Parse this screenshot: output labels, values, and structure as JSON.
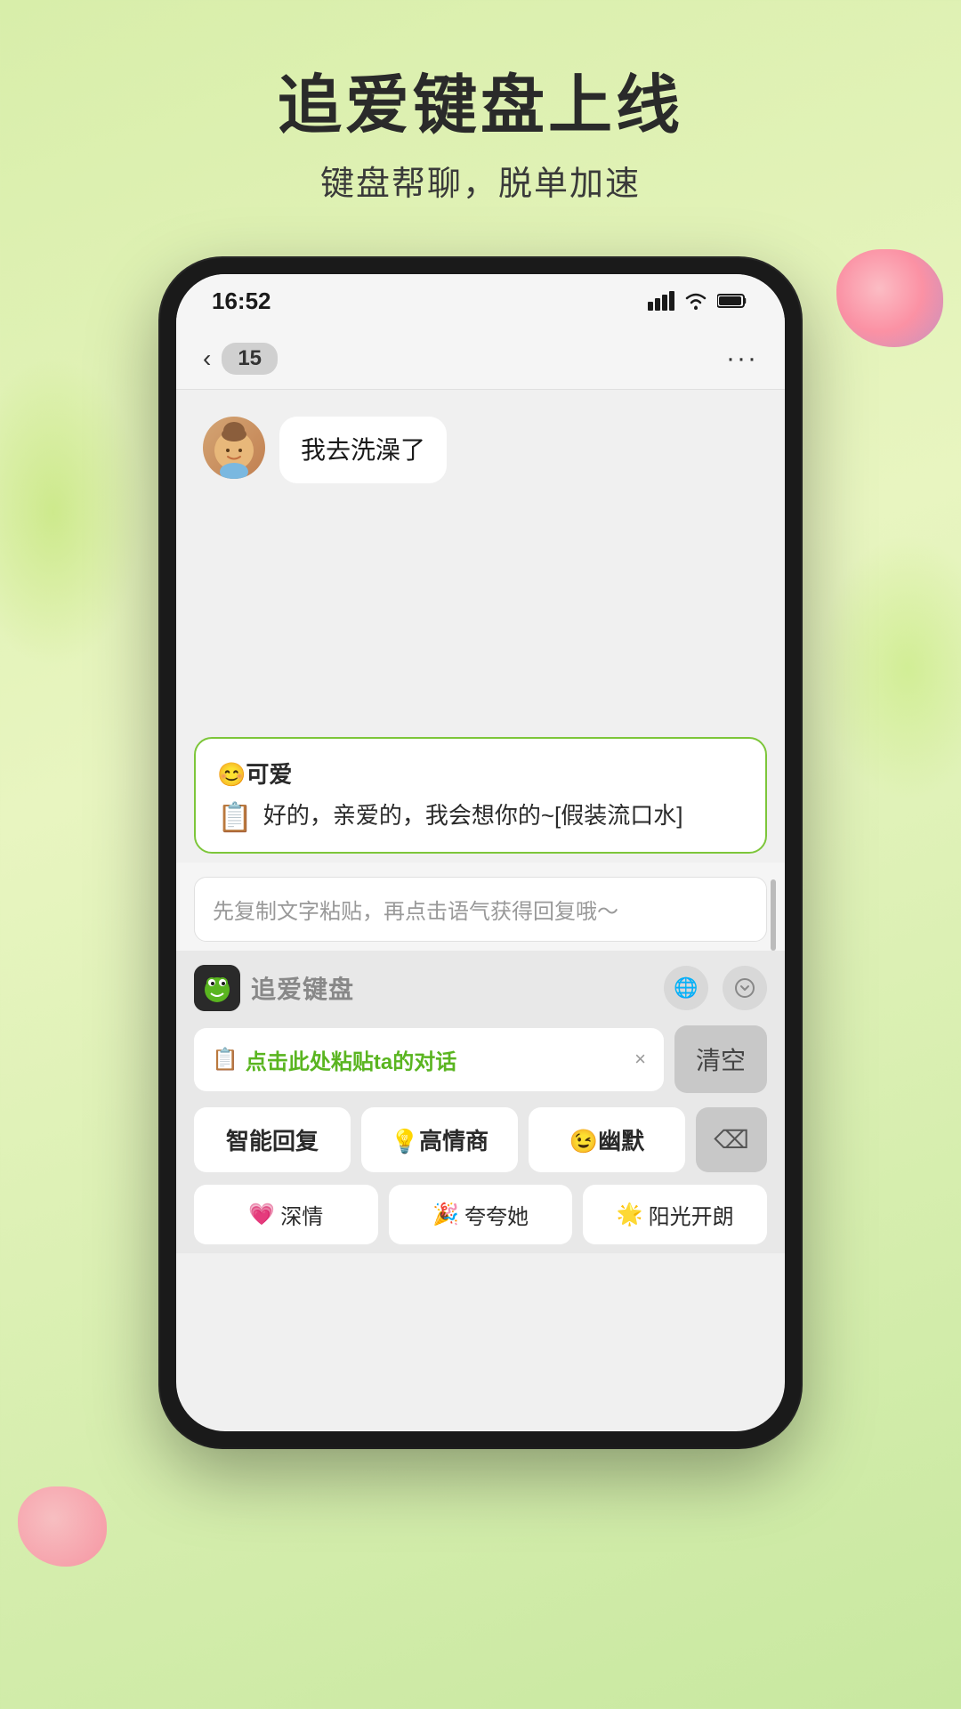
{
  "page": {
    "title": "追爱键盘上线",
    "subtitle": "键盘帮聊，脱单加速"
  },
  "status_bar": {
    "time": "16:52",
    "signal": "▲▲▲",
    "wifi": "WiFi",
    "battery": "Battery"
  },
  "chat_header": {
    "back_label": "‹",
    "badge": "15",
    "more_label": "···"
  },
  "chat": {
    "received_message": "我去洗澡了",
    "suggestion_title": "😊可爱",
    "suggestion_copy_icon": "📋",
    "suggestion_text": "好的，亲爱的，我会想你的~[假装流口水]"
  },
  "input": {
    "placeholder": "先复制文字粘贴，再点击语气获得回复哦～"
  },
  "keyboard": {
    "brand_name": "追爱键盘",
    "globe_icon": "🌐",
    "down_icon": "⊙",
    "paste_text": "点击此处粘贴ta的对话",
    "paste_icon": "📋",
    "close_icon": "×",
    "clear_label": "清空",
    "buttons": [
      {
        "label": "智能回复"
      },
      {
        "label": "💡高情商"
      },
      {
        "label": "😉幽默"
      }
    ],
    "mood_buttons": [
      {
        "emoji": "💗",
        "label": "深情"
      },
      {
        "emoji": "🎉",
        "label": "夸夸她"
      },
      {
        "emoji": "🌟",
        "label": "阳光开朗"
      }
    ],
    "delete_icon": "⌫"
  }
}
